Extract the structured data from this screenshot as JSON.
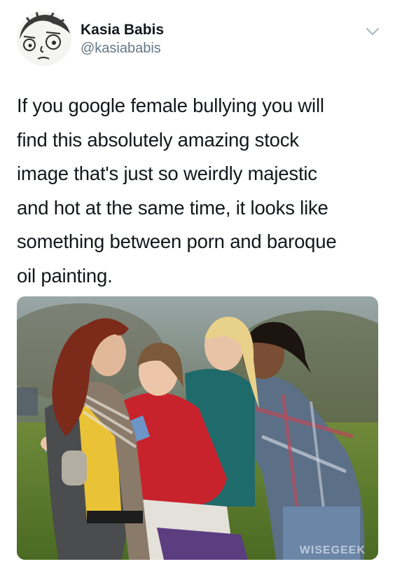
{
  "tweet": {
    "author": {
      "display_name": "Kasia Babis",
      "handle": "@kasiababis",
      "avatar_icon": "cartoon-face-avatar"
    },
    "menu_icon": "chevron-down-icon",
    "text": "If you google female bullying you will\nfind this absolutely amazing stock\nimage that's just so weirdly majestic\nand hot at the same time, it looks like\nsomething between porn and baroque\noil painting.",
    "media": {
      "watermark": "WISEGEEK"
    }
  },
  "colors": {
    "text_primary": "#14171a",
    "text_secondary": "#657786",
    "chevron": "#aab8c2",
    "background": "#ffffff"
  }
}
